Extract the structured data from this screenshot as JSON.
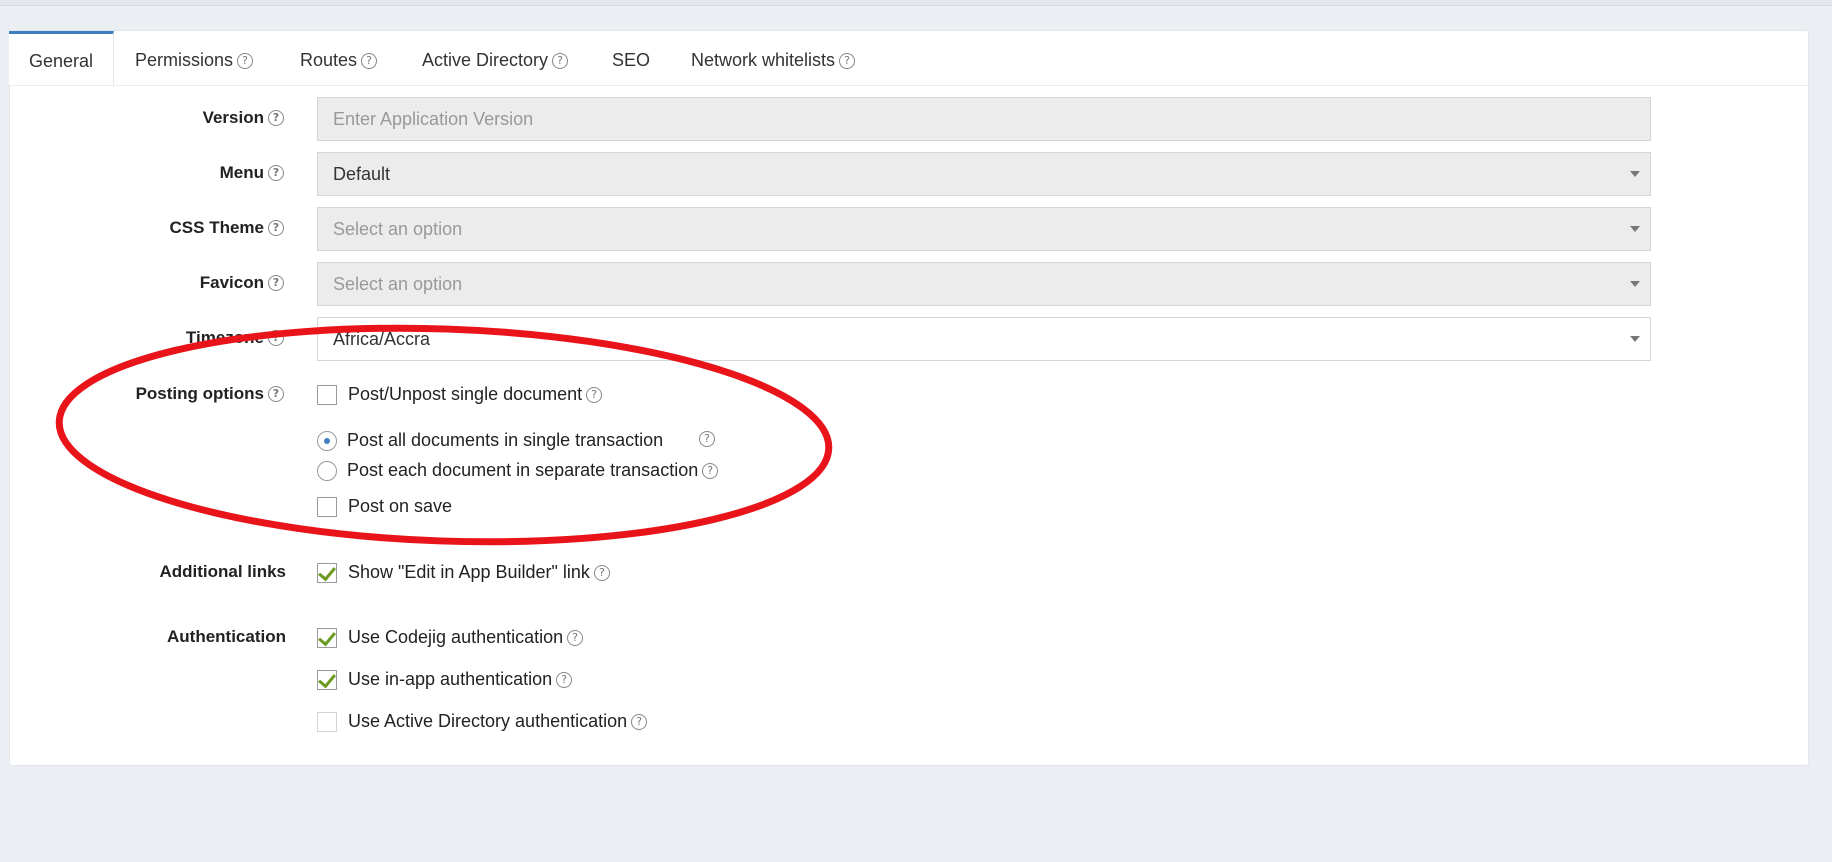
{
  "tabs": [
    {
      "label": "General",
      "help": false
    },
    {
      "label": "Permissions",
      "help": true
    },
    {
      "label": "Routes",
      "help": true
    },
    {
      "label": "Active Directory",
      "help": true
    },
    {
      "label": "SEO",
      "help": false
    },
    {
      "label": "Network whitelists",
      "help": true
    }
  ],
  "form": {
    "version": {
      "label": "Version",
      "placeholder": "Enter Application Version"
    },
    "menu": {
      "label": "Menu",
      "value": "Default"
    },
    "css_theme": {
      "label": "CSS Theme",
      "placeholder": "Select an option"
    },
    "favicon": {
      "label": "Favicon",
      "placeholder": "Select an option"
    },
    "timezone": {
      "label": "Timezone",
      "value": "Africa/Accra"
    },
    "posting": {
      "label": "Posting options",
      "single_document": {
        "label": "Post/Unpost single document",
        "checked": false
      },
      "radio_single": {
        "label": "Post all documents in single transaction",
        "selected": true
      },
      "radio_separate": {
        "label": "Post each document in separate transaction",
        "selected": false
      },
      "post_on_save": {
        "label": "Post on save",
        "checked": false
      }
    },
    "additional_links": {
      "label": "Additional links",
      "edit_in_builder": {
        "label": "Show \"Edit in App Builder\" link",
        "checked": true
      }
    },
    "authentication": {
      "label": "Authentication",
      "codejig": {
        "label": "Use Codejig authentication",
        "checked": true
      },
      "in_app": {
        "label": "Use in-app authentication",
        "checked": true
      },
      "active_directory": {
        "label": "Use Active Directory authentication",
        "checked": false
      }
    }
  },
  "help_glyph": "?",
  "colors": {
    "accent": "#3c7fc0",
    "check": "#6a9a1f",
    "annotation": "#e8141a"
  }
}
